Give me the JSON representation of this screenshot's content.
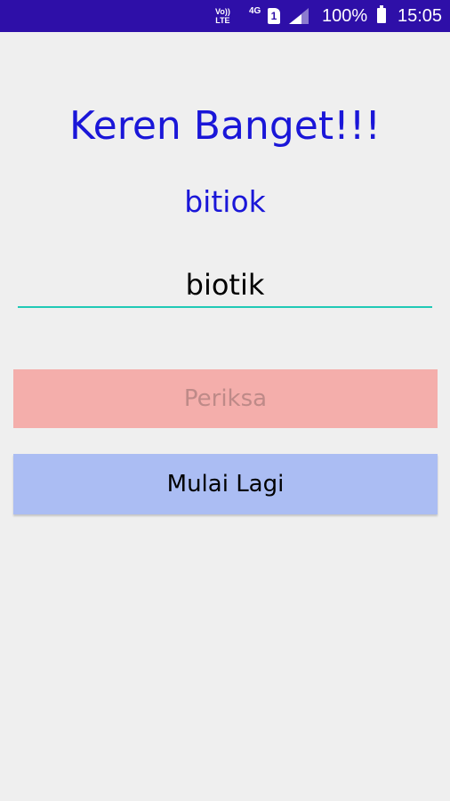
{
  "status_bar": {
    "volte_line1": "Vo))",
    "volte_line2": "LTE",
    "network": "4G",
    "sim": "1",
    "battery_percent": "100%",
    "time": "15:05"
  },
  "game": {
    "title": "Keren Banget!!!",
    "scrambled_word": "bitiok",
    "answer_value": "biotik",
    "check_button_label": "Periksa",
    "restart_button_label": "Mulai Lagi"
  },
  "colors": {
    "status_bar": "#2e0fa8",
    "title_text": "#1a16d8",
    "input_underline": "#20c9b6",
    "check_button_bg": "#f4aeab",
    "restart_button_bg": "#abbdf3",
    "background": "#efefef"
  },
  "icons": {
    "signal": "signal-strength-icon",
    "battery": "battery-icon",
    "sim": "sim-card-icon"
  }
}
